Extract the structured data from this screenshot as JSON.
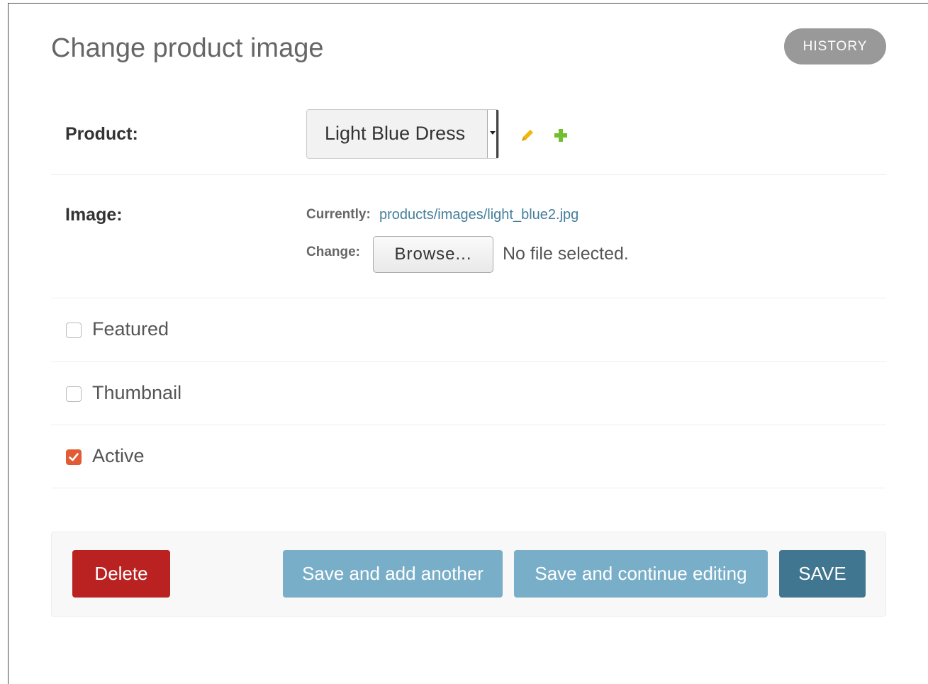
{
  "page": {
    "title": "Change product image",
    "history_label": "HISTORY"
  },
  "product_field": {
    "label": "Product:",
    "selected_value": "Light Blue Dress",
    "edit_icon": "pencil-icon",
    "add_icon": "plus-icon"
  },
  "image_field": {
    "label": "Image:",
    "currently_label": "Currently:",
    "current_file": "products/images/light_blue2.jpg",
    "change_label": "Change:",
    "browse_label": "Browse...",
    "no_file_text": "No file selected."
  },
  "checkboxes": [
    {
      "label": "Featured",
      "checked": false
    },
    {
      "label": "Thumbnail",
      "checked": false
    },
    {
      "label": "Active",
      "checked": true
    }
  ],
  "actions": {
    "delete_label": "Delete",
    "save_add_another_label": "Save and add another",
    "save_continue_label": "Save and continue editing",
    "save_label": "SAVE"
  },
  "colors": {
    "link": "#447e9b",
    "delete": "#ba2121",
    "secondary_button": "#79aec8",
    "primary_button": "#417690",
    "checkbox_checked": "#e15c35",
    "history_button": "#999999",
    "edit_icon": "#efb80b",
    "add_icon": "#70bf2b"
  }
}
